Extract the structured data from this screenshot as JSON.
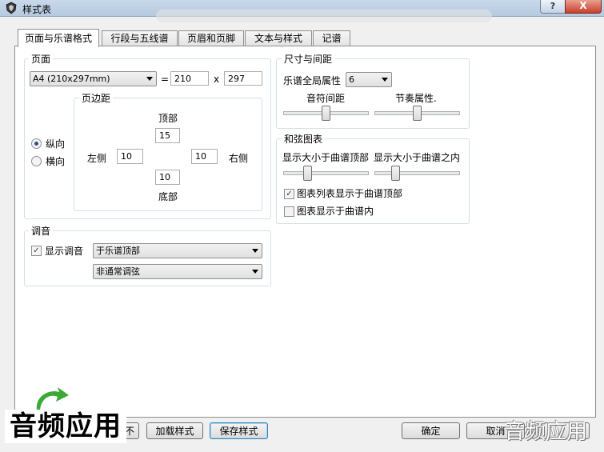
{
  "window": {
    "title": "样式表",
    "help": "?",
    "close": "X"
  },
  "tabs": [
    "页面与乐谱格式",
    "行段与五线谱",
    "页眉和页脚",
    "文本与样式",
    "记谱"
  ],
  "page": {
    "group_label": "页面",
    "paper": "A4 (210x297mm)",
    "equals": "=",
    "width": "210",
    "x": "x",
    "height": "297",
    "orientation": {
      "portrait": "纵向",
      "landscape": "横向",
      "selected": "portrait"
    },
    "margins": {
      "label": "页边距",
      "top_label": "顶部",
      "top": "15",
      "left_label": "左侧",
      "left": "10",
      "right_label": "右侧",
      "right": "10",
      "bottom_label": "底部",
      "bottom": "10"
    }
  },
  "size": {
    "group_label": "尺寸与间距",
    "global_label": "乐谱全局属性",
    "global_value": "6",
    "note_spacing": "音符间距",
    "rhythm": "节奏属性.",
    "note_spacing_level": 0.45,
    "rhythm_level": 0.45
  },
  "chord": {
    "group_label": "和弦图表",
    "size_above": "显示大小于曲谱顶部",
    "size_within": "显示大小于曲谱之内",
    "size_above_level": 0.25,
    "size_within_level": 0.2,
    "check1": "图表列表显示于曲谱顶部",
    "check1_on": true,
    "check2": "图表显示于曲谱内",
    "check2_on": false
  },
  "tuning": {
    "group_label": "调音",
    "show_label": "显示调音",
    "show_on": true,
    "position": "于乐谱顶部",
    "type": "非通常调弦"
  },
  "buttons": {
    "load": "加载样式",
    "save": "保存样式",
    "ok": "确定",
    "cancel": "取消",
    "partial_left": "不"
  },
  "watermark": {
    "left": "音频应用",
    "right": "音频应用"
  }
}
